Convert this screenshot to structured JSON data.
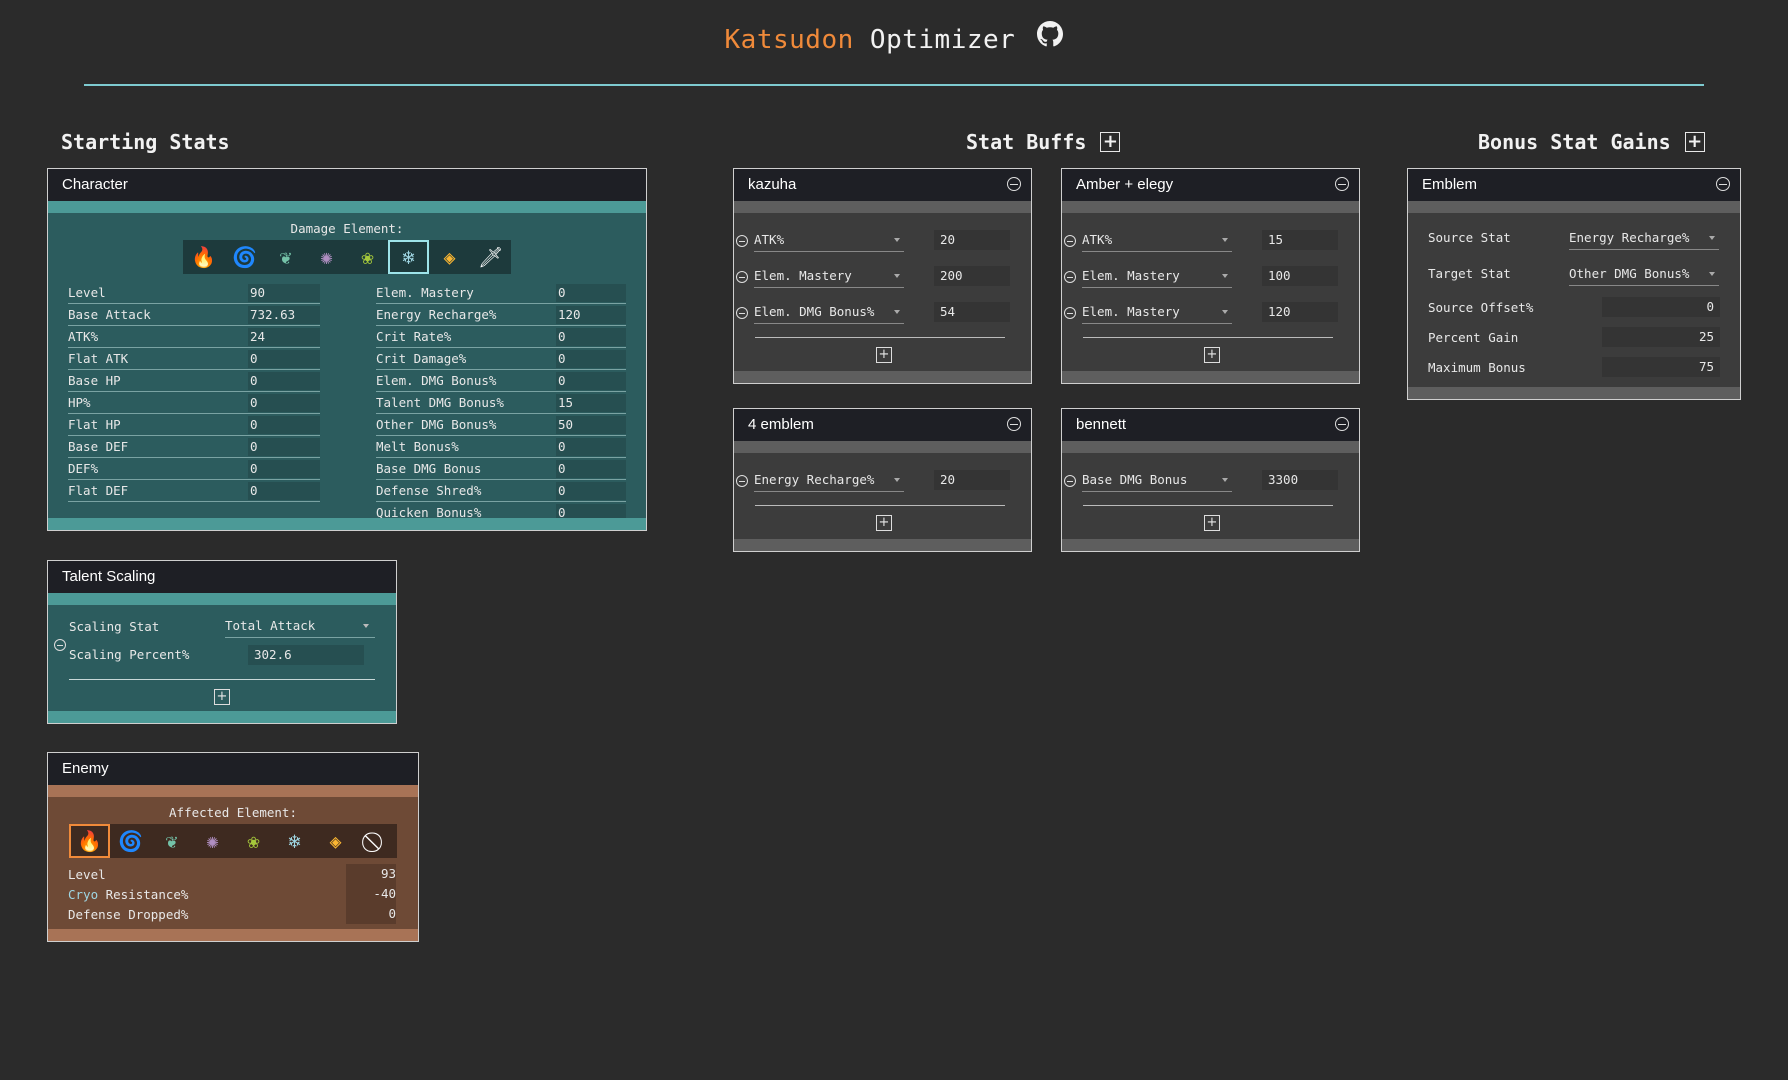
{
  "header": {
    "brand": "Katsudon",
    "title_rest": "Optimizer",
    "github_icon": "github-icon"
  },
  "sections": {
    "starting_stats": "Starting Stats",
    "stat_buffs": "Stat Buffs",
    "bonus_stat_gains": "Bonus Stat Gains"
  },
  "character": {
    "title": "Character",
    "damage_element_label": "Damage Element:",
    "elements": [
      {
        "name": "pyro-icon",
        "glyph": "🔥",
        "color": "#ef7a35"
      },
      {
        "name": "hydro-icon",
        "glyph": "🌀",
        "color": "#4cc3f1"
      },
      {
        "name": "anemo-icon",
        "glyph": "❦",
        "color": "#74c2a8"
      },
      {
        "name": "electro-icon",
        "glyph": "✺",
        "color": "#b08fc2"
      },
      {
        "name": "dendro-icon",
        "glyph": "❀",
        "color": "#a5c83b"
      },
      {
        "name": "cryo-icon",
        "glyph": "❄",
        "color": "#9fd6e3"
      },
      {
        "name": "geo-icon",
        "glyph": "◈",
        "color": "#fab632"
      },
      {
        "name": "physical-icon",
        "glyph": "🗡",
        "color": "#ffffff"
      }
    ],
    "selected_element": 5,
    "left_stats": [
      {
        "label": "Level",
        "value": "90"
      },
      {
        "label": "Base Attack",
        "value": "732.63"
      },
      {
        "label": "ATK%",
        "value": "24"
      },
      {
        "label": "Flat ATK",
        "value": "0"
      },
      {
        "label": "Base HP",
        "value": "0"
      },
      {
        "label": "HP%",
        "value": "0"
      },
      {
        "label": "Flat HP",
        "value": "0"
      },
      {
        "label": "Base DEF",
        "value": "0"
      },
      {
        "label": "DEF%",
        "value": "0"
      },
      {
        "label": "Flat DEF",
        "value": "0"
      }
    ],
    "right_stats": [
      {
        "label": "Elem. Mastery",
        "value": "0"
      },
      {
        "label": "Energy Recharge%",
        "value": "120"
      },
      {
        "label": "Crit Rate%",
        "value": "0"
      },
      {
        "label": "Crit Damage%",
        "value": "0"
      },
      {
        "label": "Elem. DMG Bonus%",
        "value": "0"
      },
      {
        "label": "Talent DMG Bonus%",
        "value": "15"
      },
      {
        "label": "Other DMG Bonus%",
        "value": "50"
      },
      {
        "label": "Melt Bonus%",
        "value": "0"
      },
      {
        "label": "Base DMG Bonus",
        "value": "0"
      },
      {
        "label": "Defense Shred%",
        "value": "0"
      },
      {
        "label": "Quicken Bonus%",
        "value": "0"
      }
    ]
  },
  "talent": {
    "title": "Talent Scaling",
    "scaling_stat_label": "Scaling Stat",
    "scaling_stat_value": "Total Attack",
    "scaling_percent_label": "Scaling Percent%",
    "scaling_percent_value": "302.6"
  },
  "enemy": {
    "title": "Enemy",
    "affected_element_label": "Affected Element:",
    "elements": [
      {
        "name": "pyro-icon",
        "glyph": "🔥",
        "color": "#ef7a35"
      },
      {
        "name": "hydro-icon",
        "glyph": "🌀",
        "color": "#4cc3f1"
      },
      {
        "name": "anemo-icon",
        "glyph": "❦",
        "color": "#74c2a8"
      },
      {
        "name": "electro-icon",
        "glyph": "✺",
        "color": "#b08fc2"
      },
      {
        "name": "dendro-icon",
        "glyph": "❀",
        "color": "#a5c83b"
      },
      {
        "name": "cryo-icon",
        "glyph": "❄",
        "color": "#9fd6e3"
      },
      {
        "name": "geo-icon",
        "glyph": "◈",
        "color": "#fab632"
      },
      {
        "name": "none-icon",
        "glyph": "⃠",
        "color": "#ffffff"
      }
    ],
    "selected_element": 0,
    "level_label": "Level",
    "level_value": "93",
    "resistance_element": "Cryo",
    "resistance_element_color": "#9fd6e3",
    "resistance_label": " Resistance%",
    "resistance_value": "-40",
    "defense_dropped_label": "Defense Dropped%",
    "defense_dropped_value": "0"
  },
  "buffs": [
    {
      "name": "kazuha",
      "rows": [
        {
          "stat": "ATK%",
          "value": "20"
        },
        {
          "stat": "Elem. Mastery",
          "value": "200"
        },
        {
          "stat": "Elem. DMG Bonus%",
          "value": "54"
        }
      ]
    },
    {
      "name": "Amber + elegy",
      "rows": [
        {
          "stat": "ATK%",
          "value": "15"
        },
        {
          "stat": "Elem. Mastery",
          "value": "100"
        },
        {
          "stat": "Elem. Mastery",
          "value": "120"
        }
      ]
    },
    {
      "name": "4 emblem",
      "rows": [
        {
          "stat": "Energy Recharge%",
          "value": "20"
        }
      ]
    },
    {
      "name": "bennett",
      "rows": [
        {
          "stat": "Base DMG Bonus",
          "value": "3300"
        }
      ]
    }
  ],
  "bonus": {
    "title": "Emblem",
    "source_stat_label": "Source Stat",
    "source_stat_value": "Energy Recharge%",
    "target_stat_label": "Target Stat",
    "target_stat_value": "Other DMG Bonus%",
    "source_offset_label": "Source Offset%",
    "source_offset_value": "0",
    "percent_gain_label": "Percent Gain",
    "percent_gain_value": "25",
    "maximum_bonus_label": "Maximum Bonus",
    "maximum_bonus_value": "75"
  }
}
